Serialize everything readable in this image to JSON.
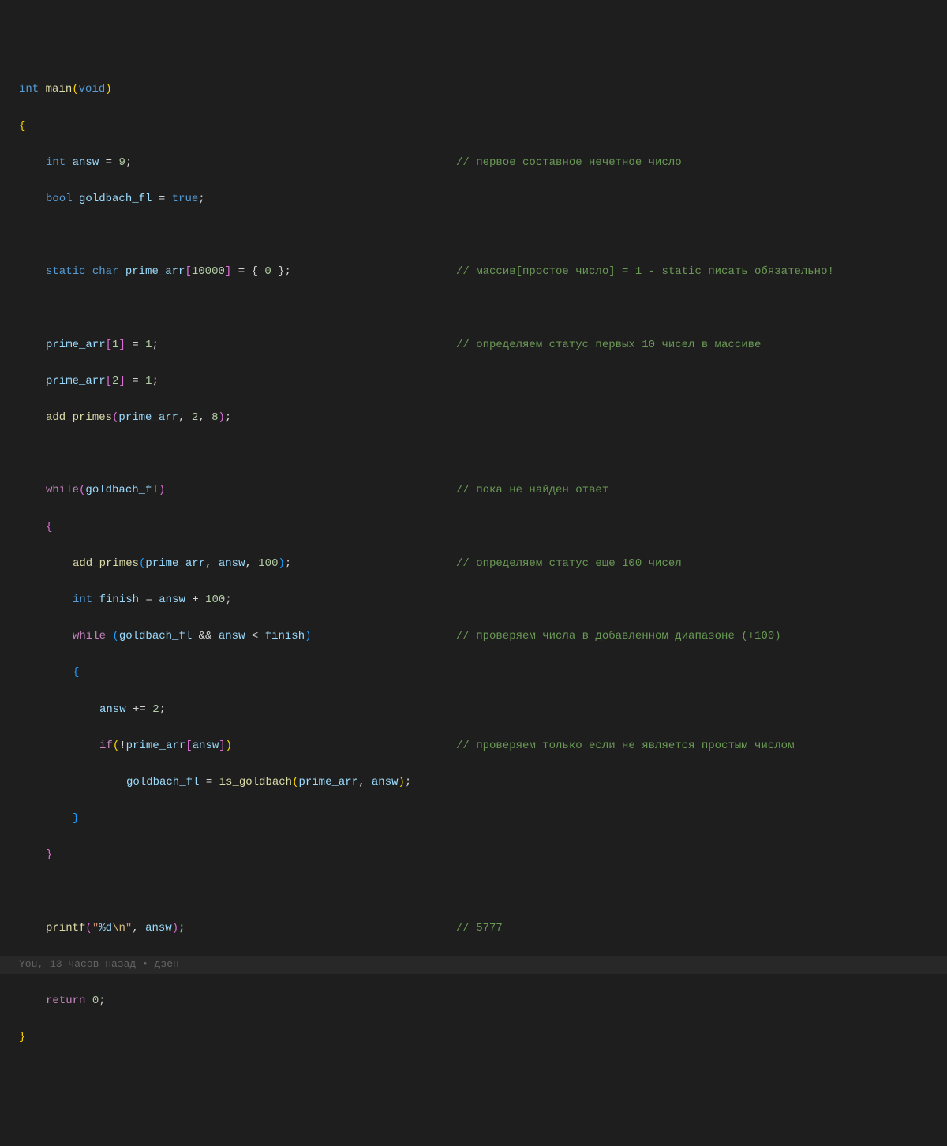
{
  "line1": {
    "type": "int",
    "fn": "main",
    "void": "void"
  },
  "line3": {
    "type": "int",
    "var": "answ",
    "eq": " = ",
    "num": "9",
    "semi": ";",
    "comment": "// первое составное нечетное число"
  },
  "line4": {
    "type": "bool",
    "var": "goldbach_fl",
    "eq": " = ",
    "val": "true",
    "semi": ";"
  },
  "line6": {
    "kw": "static",
    "type": "char",
    "var": "prime_arr",
    "size": "10000",
    "eq": " = { ",
    "num": "0",
    "end": " };",
    "comment": "// массив[простое число] = 1 - static писать обязательно!"
  },
  "line8": {
    "var": "prime_arr",
    "idx": "1",
    "eq": " = ",
    "num": "1",
    "semi": ";",
    "comment": "// определяем статус первых 10 чисел в массиве"
  },
  "line9": {
    "var": "prime_arr",
    "idx": "2",
    "eq": " = ",
    "num": "1",
    "semi": ";"
  },
  "line10": {
    "fn": "add_primes",
    "arg1": "prime_arr",
    "arg2": "2",
    "arg3": "8"
  },
  "line12": {
    "kw": "while",
    "var": "goldbach_fl",
    "comment": "// пока не найден ответ"
  },
  "line14": {
    "fn": "add_primes",
    "arg1": "prime_arr",
    "arg2": "answ",
    "arg3": "100",
    "comment": "// определяем статус еще 100 чисел"
  },
  "line15": {
    "type": "int",
    "var": "finish",
    "eq": " = ",
    "var2": "answ",
    "op": " + ",
    "num": "100",
    "semi": ";"
  },
  "line16": {
    "kw": "while",
    "var1": "goldbach_fl",
    "op": " && ",
    "var2": "answ",
    "cmp": " < ",
    "var3": "finish",
    "comment": "// проверяем числа в добавленном диапазоне (+100)"
  },
  "line18": {
    "var": "answ",
    "op": " += ",
    "num": "2",
    "semi": ";"
  },
  "line19": {
    "kw": "if",
    "neg": "!",
    "var": "prime_arr",
    "var2": "answ",
    "comment": "// проверяем только если не является простым числом"
  },
  "line20": {
    "var": "goldbach_fl",
    "eq": " = ",
    "fn": "is_goldbach",
    "arg1": "prime_arr",
    "arg2": "answ"
  },
  "line24": {
    "fn": "printf",
    "str": "\"",
    "fmt": "%d",
    "esc": "\\n",
    "strend": "\"",
    "arg": "answ",
    "comment": "// 5777"
  },
  "line25": {
    "codelens": "You, 13 часов назад • дзен"
  },
  "line26": {
    "kw": "return",
    "num": "0",
    "semi": ";"
  }
}
